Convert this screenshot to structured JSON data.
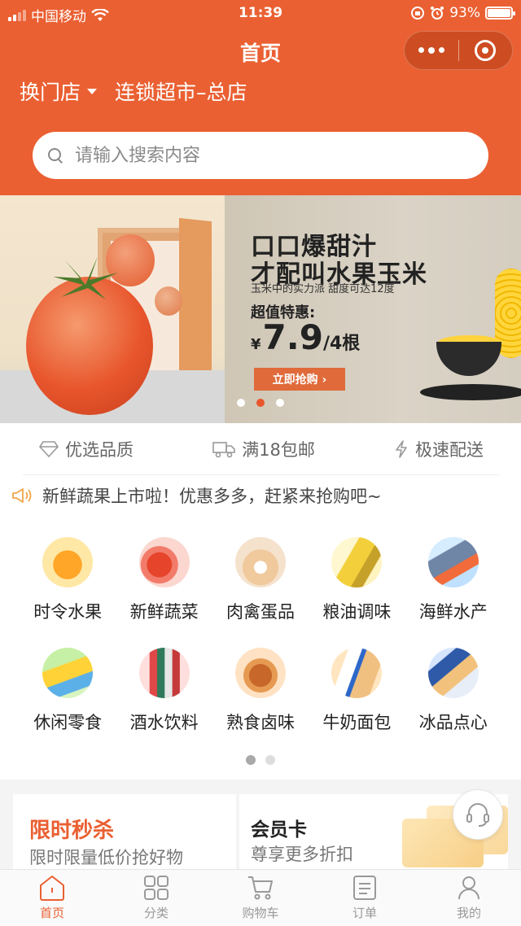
{
  "status_bar": {
    "carrier": "中国移动",
    "time": "11:39",
    "battery_text": "93%",
    "battery_level": 0.93
  },
  "nav": {
    "title": "首页"
  },
  "store": {
    "switch_label": "换门店",
    "name": "连锁超市–总店"
  },
  "search": {
    "placeholder": "请输入搜索内容"
  },
  "banner": {
    "headline_1": "口口爆甜汁",
    "headline_2": "才配叫水果玉米",
    "subline": "玉米中的实力派 甜度可达12度",
    "price_label": "超值特惠:",
    "currency": "¥",
    "price": "7.9",
    "unit": "/4根",
    "button_label": "立即抢购 ›",
    "slide_count": 3,
    "active_slide": 2
  },
  "features": [
    {
      "icon": "diamond-icon",
      "label": "优选品质"
    },
    {
      "icon": "truck-icon",
      "label": "满18包邮"
    },
    {
      "icon": "lightning-icon",
      "label": "极速配送"
    }
  ],
  "notice": {
    "icon": "megaphone-icon",
    "text": "新鲜蔬果上市啦！优惠多多，赶紧来抢购吧~"
  },
  "categories": [
    {
      "label": "时令水果",
      "icon": "orange-fruit-icon"
    },
    {
      "label": "新鲜蔬菜",
      "icon": "tomato-icon"
    },
    {
      "label": "肉禽蛋品",
      "icon": "eggs-icon"
    },
    {
      "label": "粮油调味",
      "icon": "oil-bottle-icon"
    },
    {
      "label": "海鲜水产",
      "icon": "fish-icon"
    },
    {
      "label": "休闲零食",
      "icon": "snack-icon"
    },
    {
      "label": "酒水饮料",
      "icon": "bottles-icon"
    },
    {
      "label": "熟食卤味",
      "icon": "roast-chicken-icon"
    },
    {
      "label": "牛奶面包",
      "icon": "milk-bread-icon"
    },
    {
      "label": "冰品点心",
      "icon": "ice-cream-icon"
    }
  ],
  "category_pager": {
    "pages": 2,
    "active": 1
  },
  "cards": {
    "flash_sale": {
      "title": "限时秒杀",
      "subtitle": "限时限量低价抢好物"
    },
    "member": {
      "title": "会员卡",
      "subtitle": "尊享更多折扣"
    }
  },
  "tabs": [
    {
      "label": "首页",
      "icon": "home-icon",
      "active": true
    },
    {
      "label": "分类",
      "icon": "grid-icon",
      "active": false
    },
    {
      "label": "购物车",
      "icon": "cart-icon",
      "active": false
    },
    {
      "label": "订单",
      "icon": "order-icon",
      "active": false
    },
    {
      "label": "我的",
      "icon": "user-icon",
      "active": false
    }
  ],
  "colors": {
    "brand": "#ea6032",
    "active_dot": "#e8562a"
  }
}
